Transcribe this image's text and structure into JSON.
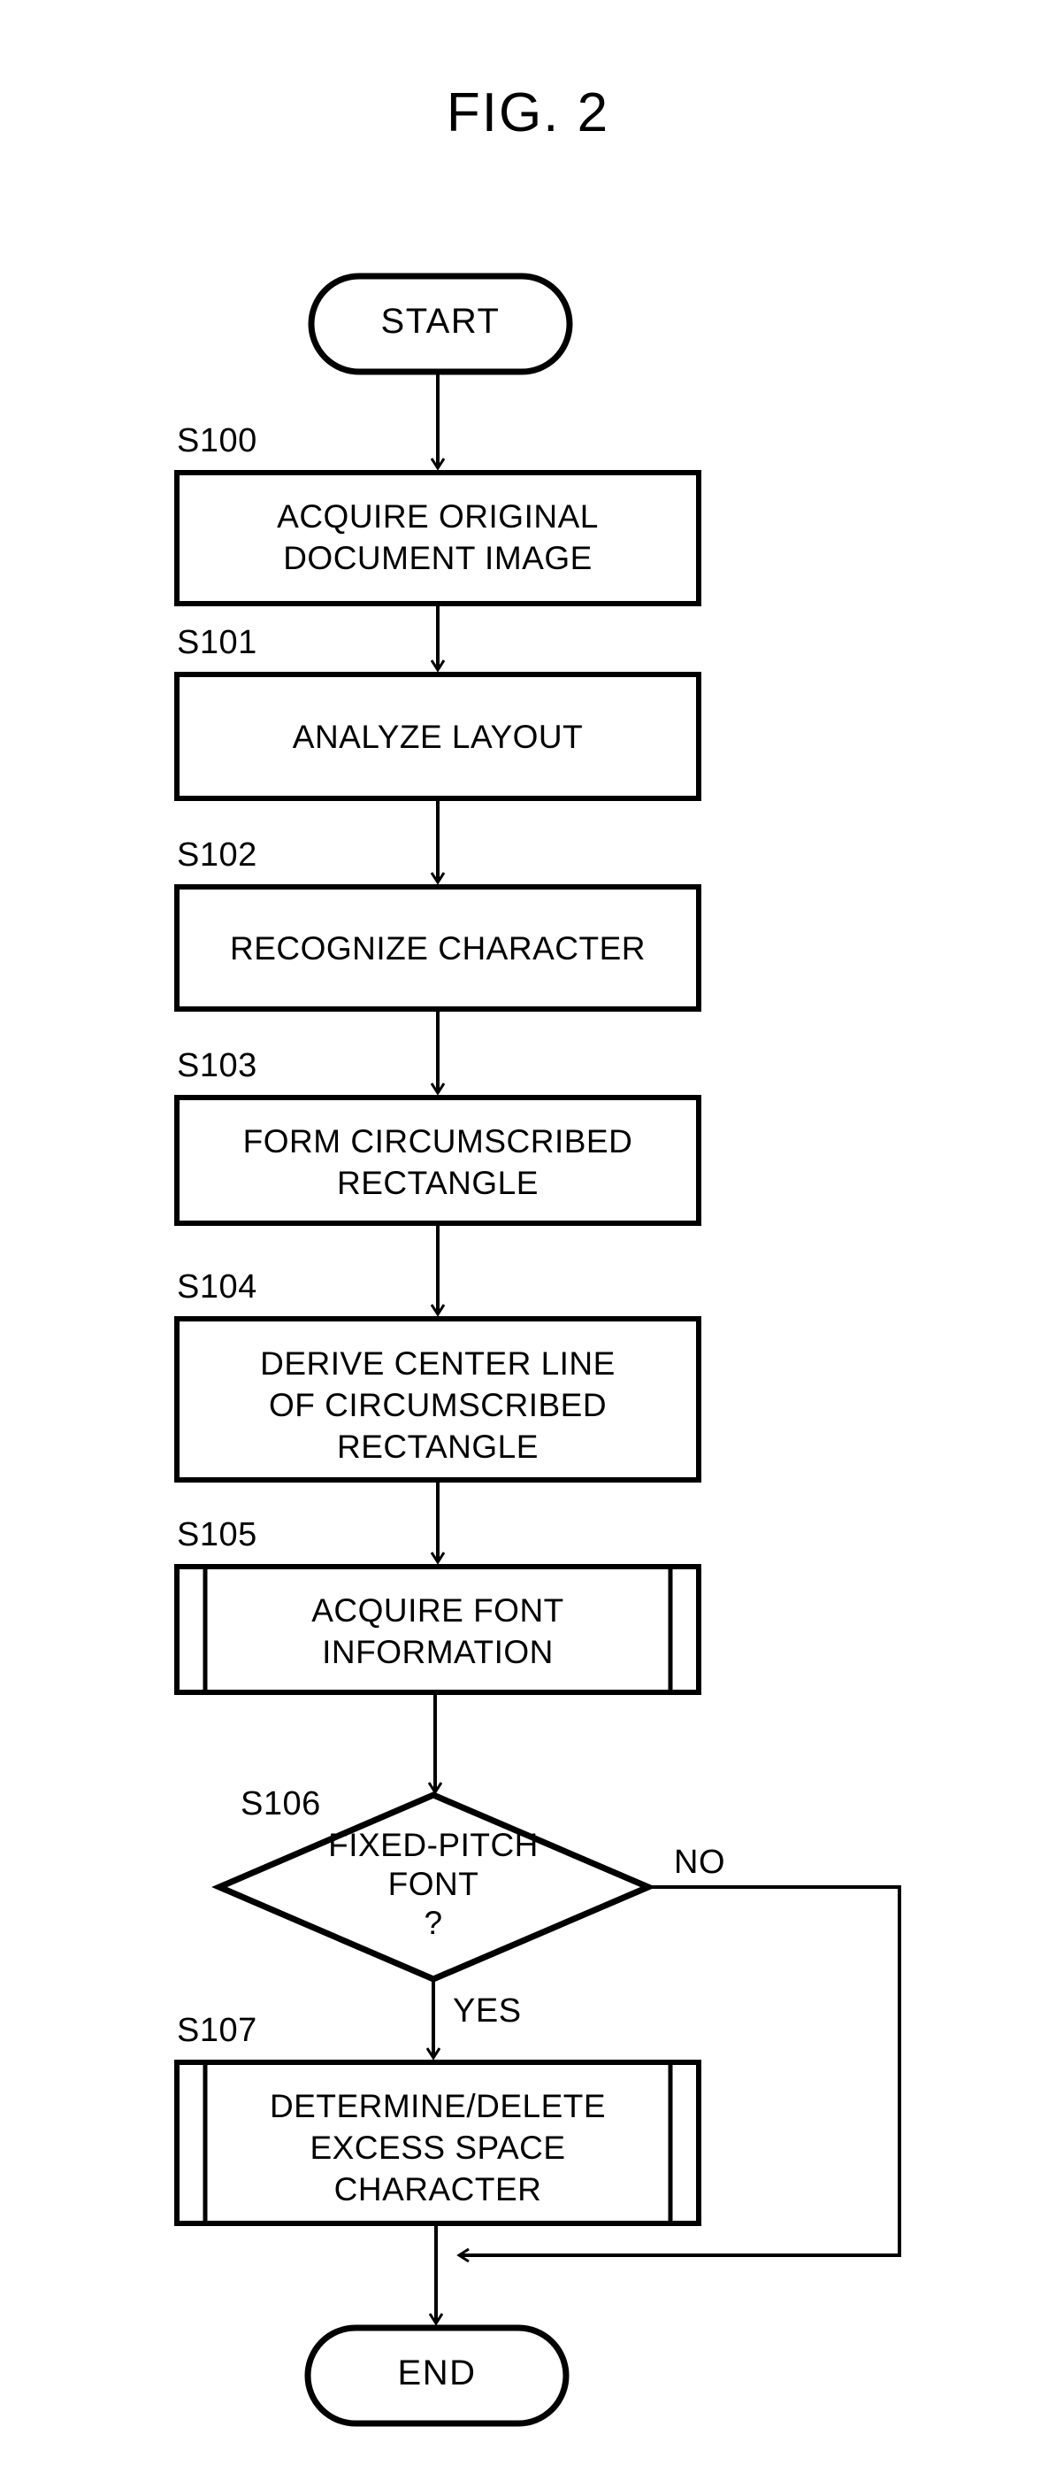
{
  "figure": {
    "title": "FIG. 2",
    "type": "flowchart"
  },
  "chart_data": {
    "type": "diagram",
    "title": "FIG. 2",
    "nodes": [
      {
        "id": "start",
        "shape": "terminator",
        "label": "START",
        "step": ""
      },
      {
        "id": "s100",
        "shape": "process",
        "label": "ACQUIRE ORIGINAL\nDOCUMENT IMAGE",
        "step": "S100"
      },
      {
        "id": "s101",
        "shape": "process",
        "label": "ANALYZE LAYOUT",
        "step": "S101"
      },
      {
        "id": "s102",
        "shape": "process",
        "label": "RECOGNIZE CHARACTER",
        "step": "S102"
      },
      {
        "id": "s103",
        "shape": "process",
        "label": "FORM CIRCUMSCRIBED\nRECTANGLE",
        "step": "S103"
      },
      {
        "id": "s104",
        "shape": "process",
        "label": "DERIVE CENTER LINE\nOF CIRCUMSCRIBED\nRECTANGLE",
        "step": "S104"
      },
      {
        "id": "s105",
        "shape": "predefined-process",
        "label": "ACQUIRE FONT\nINFORMATION",
        "step": "S105"
      },
      {
        "id": "s106",
        "shape": "decision",
        "label": "FIXED-PITCH\nFONT\n?",
        "step": "S106"
      },
      {
        "id": "s107",
        "shape": "predefined-process",
        "label": "DETERMINE/DELETE\nEXCESS SPACE\nCHARACTER",
        "step": "S107"
      },
      {
        "id": "end",
        "shape": "terminator",
        "label": "END",
        "step": ""
      }
    ],
    "edges": [
      {
        "from": "start",
        "to": "s100",
        "label": ""
      },
      {
        "from": "s100",
        "to": "s101",
        "label": ""
      },
      {
        "from": "s101",
        "to": "s102",
        "label": ""
      },
      {
        "from": "s102",
        "to": "s103",
        "label": ""
      },
      {
        "from": "s103",
        "to": "s104",
        "label": ""
      },
      {
        "from": "s104",
        "to": "s105",
        "label": ""
      },
      {
        "from": "s105",
        "to": "s106",
        "label": ""
      },
      {
        "from": "s106",
        "to": "s107",
        "label": "YES"
      },
      {
        "from": "s106",
        "to": "end",
        "label": "NO"
      },
      {
        "from": "s107",
        "to": "end",
        "label": ""
      }
    ],
    "branch_labels": {
      "yes": "YES",
      "no": "NO"
    },
    "colors": {
      "stroke": "#000000",
      "fill": "#ffffff",
      "text": "#000000"
    }
  },
  "nodes": {
    "start": {
      "label": "START"
    },
    "s100": {
      "step": "S100",
      "label": "ACQUIRE ORIGINAL\nDOCUMENT IMAGE"
    },
    "s101": {
      "step": "S101",
      "label": "ANALYZE LAYOUT"
    },
    "s102": {
      "step": "S102",
      "label": "RECOGNIZE CHARACTER"
    },
    "s103": {
      "step": "S103",
      "label": "FORM CIRCUMSCRIBED\nRECTANGLE"
    },
    "s104": {
      "step": "S104",
      "label": "DERIVE CENTER LINE\nOF CIRCUMSCRIBED\nRECTANGLE"
    },
    "s105": {
      "step": "S105",
      "label": "ACQUIRE FONT\nINFORMATION"
    },
    "s106": {
      "step": "S106",
      "label": "FIXED-PITCH\nFONT\n?"
    },
    "s107": {
      "step": "S107",
      "label": "DETERMINE/DELETE\nEXCESS SPACE\nCHARACTER"
    },
    "end": {
      "label": "END"
    }
  },
  "branches": {
    "no": "NO",
    "yes": "YES"
  }
}
